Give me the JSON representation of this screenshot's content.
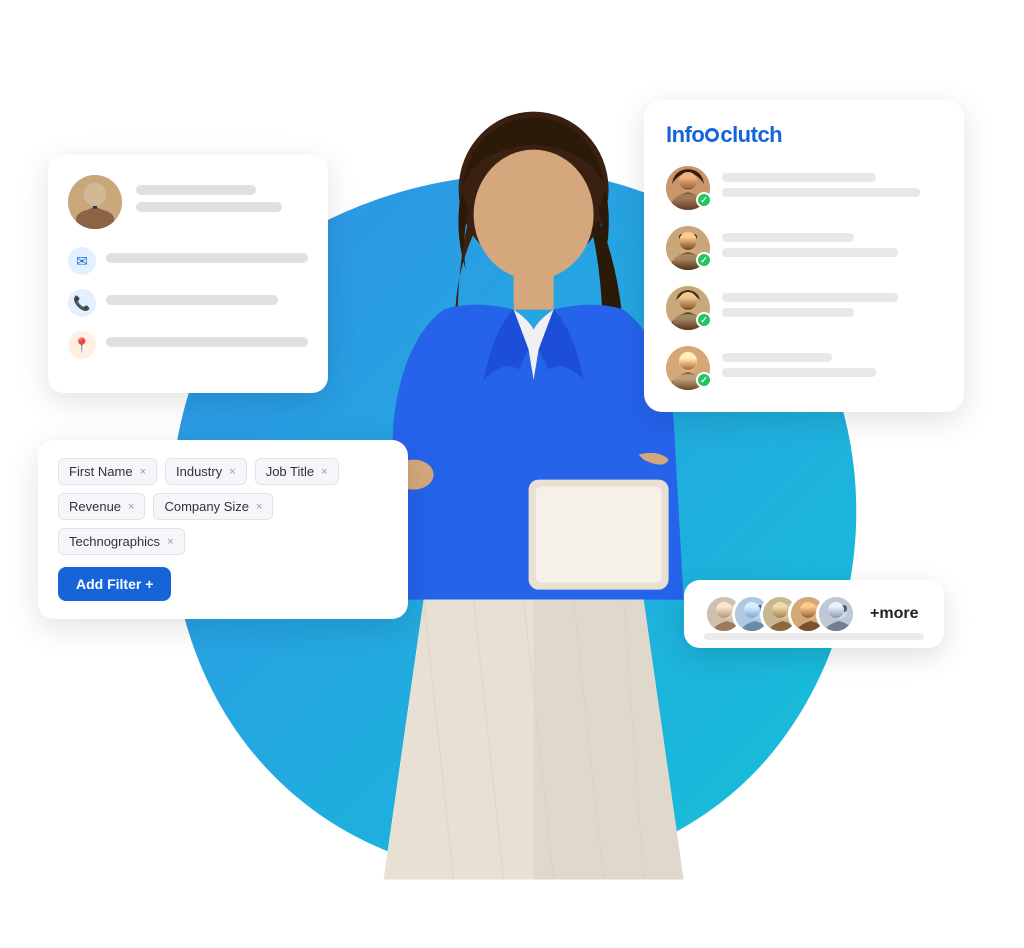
{
  "logo": {
    "text": "Infoclutch",
    "text_info": "Info",
    "text_clutch": "clutch"
  },
  "profile_card": {
    "contact_rows": [
      {
        "icon": "✉",
        "type": "mail"
      },
      {
        "icon": "📞",
        "type": "phone"
      },
      {
        "icon": "📍",
        "type": "location"
      }
    ]
  },
  "filter_card": {
    "tags": [
      {
        "label": "First Name",
        "id": "first-name"
      },
      {
        "label": "Industry",
        "id": "industry"
      },
      {
        "label": "Job Title",
        "id": "job-title"
      },
      {
        "label": "Revenue",
        "id": "revenue"
      },
      {
        "label": "Company Size",
        "id": "company-size"
      },
      {
        "label": "Technographics",
        "id": "technographics"
      }
    ],
    "add_filter_label": "Add Filter +",
    "close_symbol": "×"
  },
  "contact_list": {
    "items": [
      {
        "type": "female",
        "check": "✓"
      },
      {
        "type": "male1",
        "check": "✓"
      },
      {
        "type": "male2",
        "check": "✓"
      },
      {
        "type": "male3",
        "check": "✓"
      }
    ]
  },
  "more_card": {
    "more_text": "+more"
  },
  "colors": {
    "primary_blue": "#1565d8",
    "light_blue": "#e3f0ff",
    "green": "#22c55e",
    "bg_blob_start": "#1e88e5",
    "bg_blob_end": "#00bcd4"
  }
}
